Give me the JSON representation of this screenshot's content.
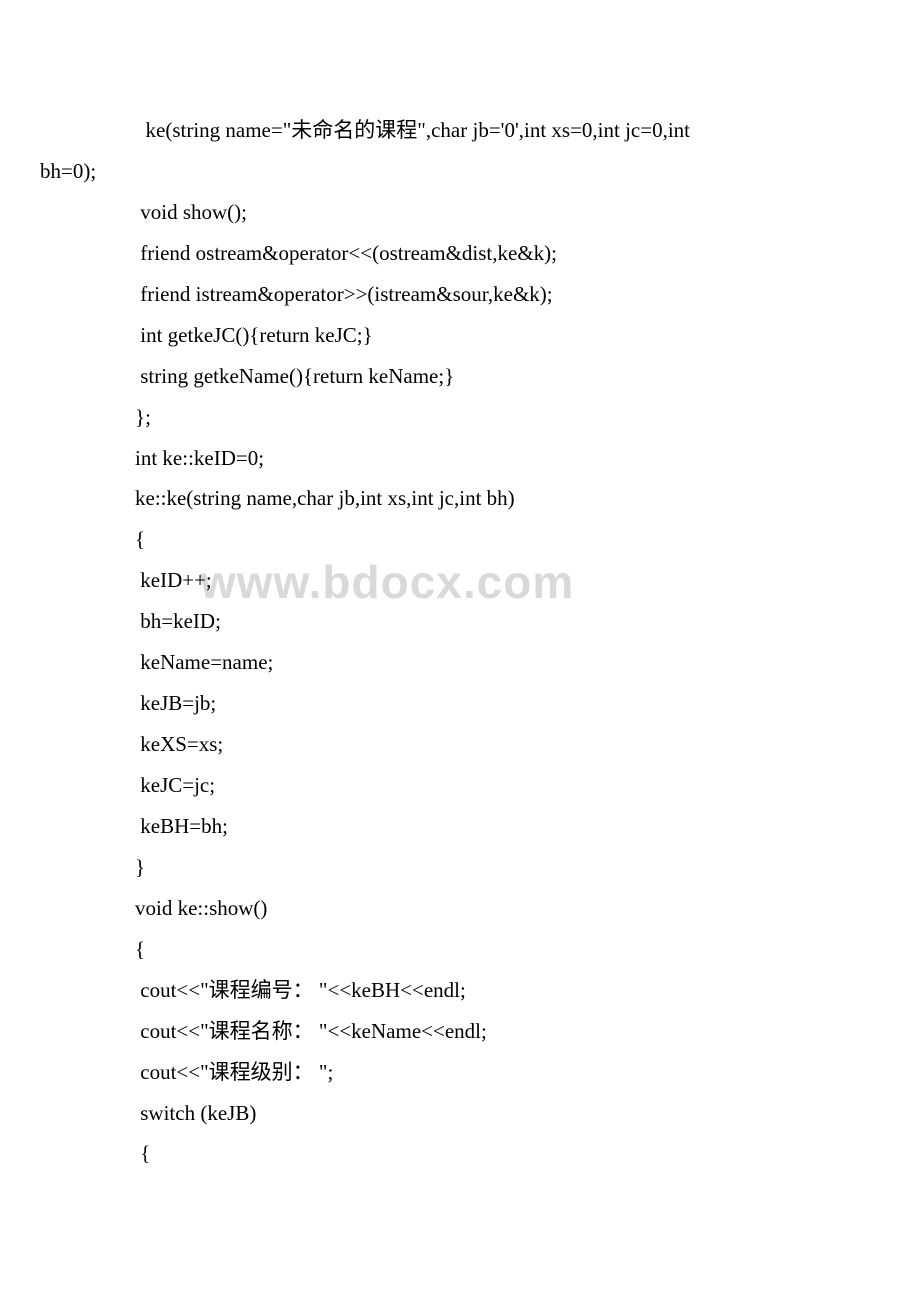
{
  "watermark": "www.bdocx.com",
  "lines": [
    {
      "cls": "code-line",
      "text": "  ke(string name=\"未命名的课程\",char jb='0',int xs=0,int jc=0,int "
    },
    {
      "cls": "code-line wrap",
      "text": "bh=0);"
    },
    {
      "cls": "code-line",
      "text": " void show();"
    },
    {
      "cls": "code-line",
      "text": " friend ostream&operator<<(ostream&dist,ke&k);"
    },
    {
      "cls": "code-line",
      "text": " friend istream&operator>>(istream&sour,ke&k);"
    },
    {
      "cls": "code-line",
      "text": " int getkeJC(){return keJC;}"
    },
    {
      "cls": "code-line",
      "text": " string getkeName(){return keName;}"
    },
    {
      "cls": "code-line",
      "text": "};"
    },
    {
      "cls": "code-line",
      "text": "int ke::keID=0;"
    },
    {
      "cls": "code-line",
      "text": "ke::ke(string name,char jb,int xs,int jc,int bh)"
    },
    {
      "cls": "code-line",
      "text": "{"
    },
    {
      "cls": "code-line",
      "text": " keID++;"
    },
    {
      "cls": "code-line",
      "text": " bh=keID;"
    },
    {
      "cls": "code-line",
      "text": " keName=name;"
    },
    {
      "cls": "code-line",
      "text": " keJB=jb;"
    },
    {
      "cls": "code-line",
      "text": " keXS=xs;"
    },
    {
      "cls": "code-line",
      "text": " keJC=jc;"
    },
    {
      "cls": "code-line",
      "text": " keBH=bh;"
    },
    {
      "cls": "code-line",
      "text": "}"
    },
    {
      "cls": "code-line",
      "text": "void ke::show()"
    },
    {
      "cls": "code-line",
      "text": "{"
    },
    {
      "cls": "code-line",
      "text": " cout<<\"课程编号： \"<<keBH<<endl;"
    },
    {
      "cls": "code-line",
      "text": " cout<<\"课程名称： \"<<keName<<endl;"
    },
    {
      "cls": "code-line",
      "text": " cout<<\"课程级别： \";"
    },
    {
      "cls": "code-line",
      "text": " switch (keJB)"
    },
    {
      "cls": "code-line",
      "text": " {"
    }
  ]
}
